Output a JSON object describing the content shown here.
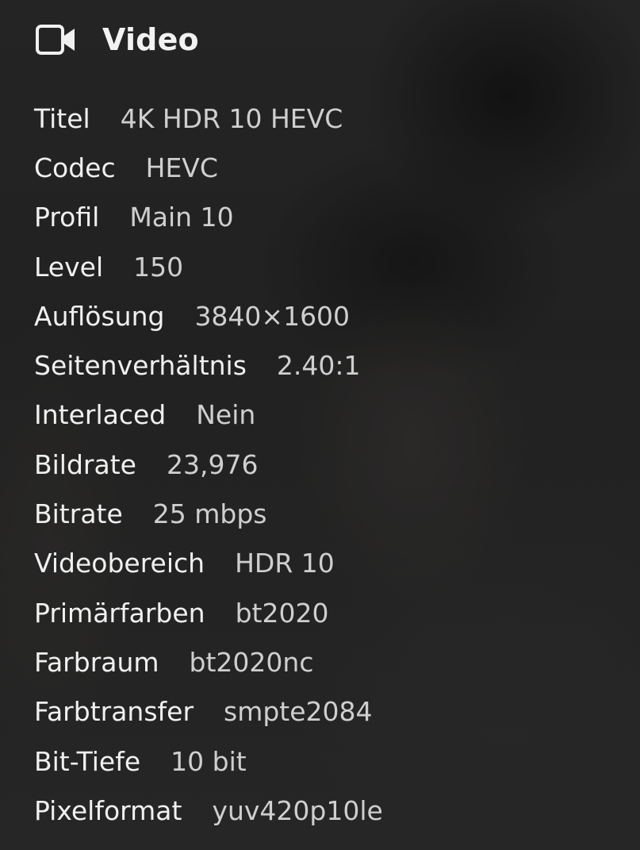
{
  "section": {
    "title": "Video",
    "icon": "video-camera-icon"
  },
  "rows": [
    {
      "label": "Titel",
      "value": "4K HDR 10 HEVC"
    },
    {
      "label": "Codec",
      "value": "HEVC"
    },
    {
      "label": "Profil",
      "value": "Main 10"
    },
    {
      "label": "Level",
      "value": "150"
    },
    {
      "label": "Auflösung",
      "value": "3840×1600"
    },
    {
      "label": "Seitenverhältnis",
      "value": "2.40:1"
    },
    {
      "label": "Interlaced",
      "value": "Nein"
    },
    {
      "label": "Bildrate",
      "value": "23,976"
    },
    {
      "label": "Bitrate",
      "value": "25 mbps"
    },
    {
      "label": "Videobereich",
      "value": "HDR 10"
    },
    {
      "label": "Primärfarben",
      "value": "bt2020"
    },
    {
      "label": "Farbraum",
      "value": "bt2020nc"
    },
    {
      "label": "Farbtransfer",
      "value": "smpte2084"
    },
    {
      "label": "Bit-Tiefe",
      "value": "10 bit"
    },
    {
      "label": "Pixelformat",
      "value": "yuv420p10le"
    }
  ],
  "colors": {
    "label": "#f0f0f0",
    "value": "#cfcfcf",
    "background": "#262626"
  }
}
